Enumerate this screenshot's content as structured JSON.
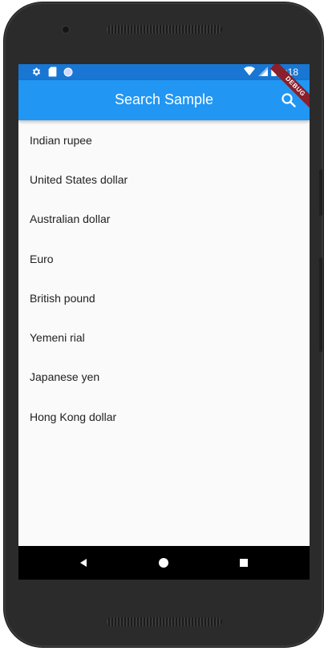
{
  "status_bar": {
    "time": "8:18",
    "left_icons": [
      "settings-icon",
      "sd-card-icon",
      "circle-icon"
    ],
    "right_icons": [
      "wifi-icon",
      "signal-icon",
      "battery-icon"
    ]
  },
  "app_bar": {
    "title": "Search Sample",
    "action_icon": "search-icon"
  },
  "debug_banner": "DEBUG",
  "currencies": [
    "Indian rupee",
    "United States dollar",
    "Australian dollar",
    "Euro",
    "British pound",
    "Yemeni rial",
    "Japanese yen",
    "Hong Kong dollar"
  ],
  "nav_bar": {
    "buttons": [
      "back-icon",
      "home-icon",
      "recents-icon"
    ]
  },
  "colors": {
    "status_bar": "#1976d2",
    "app_bar": "#2196f3",
    "background": "#fafafa",
    "debug_banner": "#8b1f2a"
  }
}
